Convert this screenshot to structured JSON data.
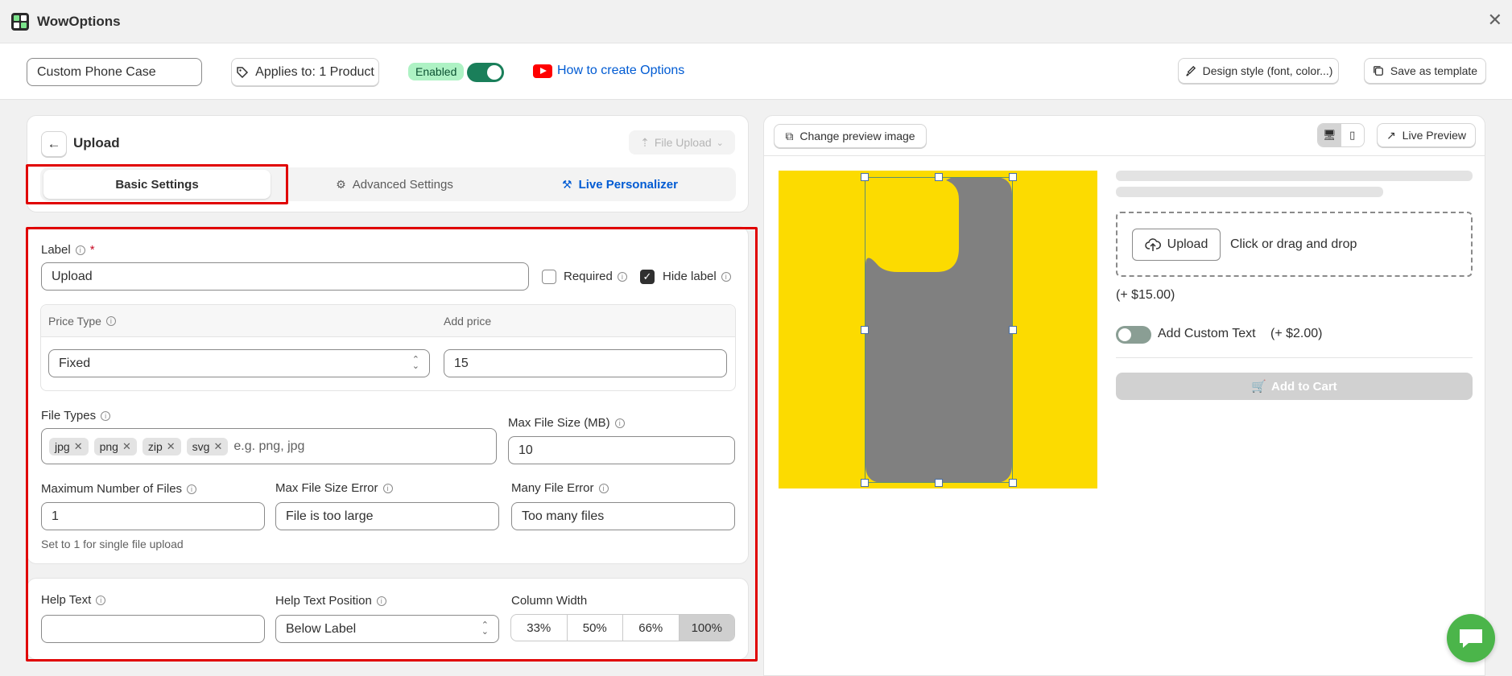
{
  "app": {
    "title": "WowOptions"
  },
  "topbar": {
    "option_name": "Custom Phone Case",
    "applies_label": "Applies to: 1 Product",
    "enabled_label": "Enabled",
    "enabled": true,
    "howto_label": "How to create Options",
    "design_label": "Design style (font, color...)",
    "save_template_label": "Save as template"
  },
  "editor": {
    "title": "Upload",
    "type_label": "File Upload",
    "tabs": [
      {
        "label": "Basic Settings",
        "active": true
      },
      {
        "label": "Advanced Settings",
        "active": false
      },
      {
        "label": "Live Personalizer",
        "active": false
      }
    ],
    "basic": {
      "label_title": "Label",
      "label_value": "Upload",
      "required_label": "Required",
      "required_checked": false,
      "hide_label_label": "Hide label",
      "hide_label_checked": true,
      "price_type_header": "Price Type",
      "add_price_header": "Add price",
      "price_type_value": "Fixed",
      "price_value": "15",
      "file_types_label": "File Types",
      "file_types": [
        "jpg",
        "png",
        "zip",
        "svg"
      ],
      "file_types_placeholder": "e.g. png, jpg",
      "max_size_label": "Max File Size (MB)",
      "max_size_value": "10",
      "max_files_label": "Maximum Number of Files",
      "max_files_value": "1",
      "max_files_hint": "Set to 1 for single file upload",
      "size_error_label": "Max File Size Error",
      "size_error_value": "File is too large",
      "many_error_label": "Many File Error",
      "many_error_value": "Too many files"
    },
    "help": {
      "help_text_label": "Help Text",
      "help_text_value": "",
      "position_label": "Help Text Position",
      "position_value": "Below Label",
      "width_label": "Column Width",
      "width_options": [
        "33%",
        "50%",
        "66%",
        "100%"
      ],
      "width_selected": "100%"
    }
  },
  "preview": {
    "change_image_label": "Change preview image",
    "live_preview_label": "Live Preview",
    "upload_button_label": "Upload",
    "drop_text": "Click or drag and drop",
    "upload_price": "(+ $15.00)",
    "custom_text_label": "Add Custom Text",
    "custom_text_price": "(+ $2.00)",
    "custom_text_enabled": false,
    "add_to_cart_label": "Add to Cart",
    "canvas_color": "#fcdb00",
    "phone_color": "#808080"
  },
  "colors": {
    "accent": "#005bd3",
    "success": "#1a7f5a",
    "highlight": "#e00000"
  }
}
